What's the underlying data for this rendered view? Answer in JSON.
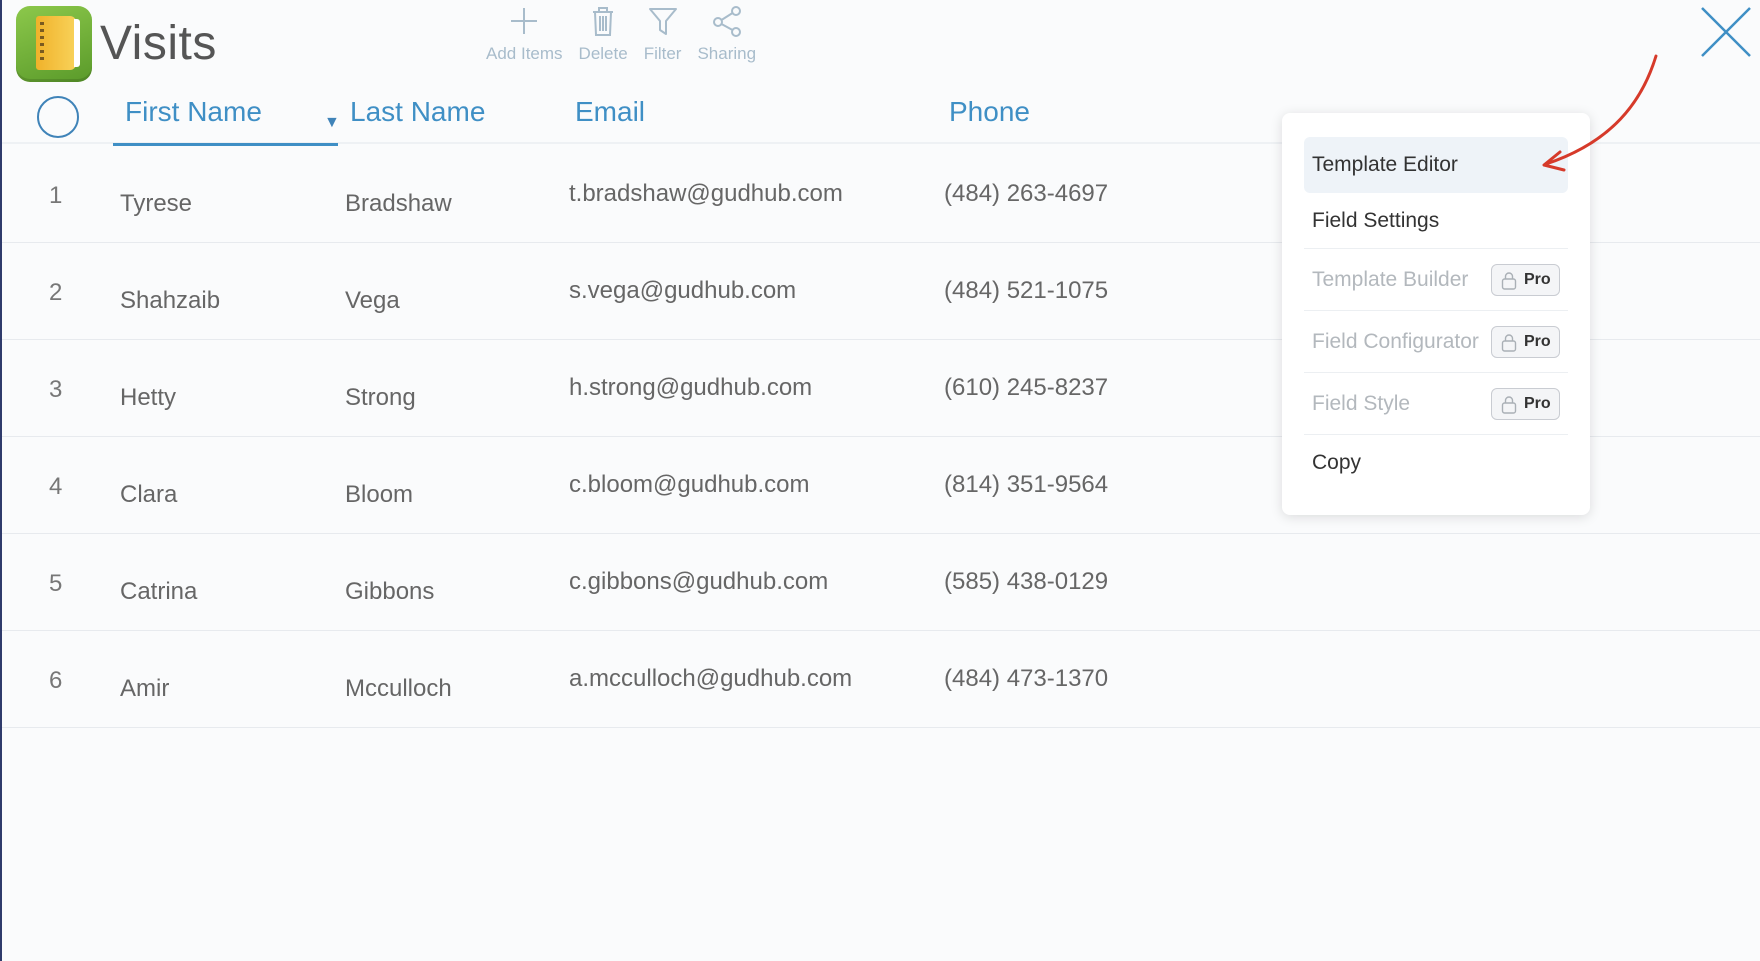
{
  "app": {
    "title": "Visits"
  },
  "toolbar": {
    "add_label": "Add Items",
    "delete_label": "Delete",
    "filter_label": "Filter",
    "sharing_label": "Sharing"
  },
  "columns": {
    "first_name": "First Name",
    "last_name": "Last Name",
    "email": "Email",
    "phone": "Phone"
  },
  "rows": [
    {
      "num": "1",
      "first": "Tyrese",
      "last": "Bradshaw",
      "email": "t.bradshaw@gudhub.com",
      "phone": "(484) 263-4697"
    },
    {
      "num": "2",
      "first": "Shahzaib",
      "last": "Vega",
      "email": "s.vega@gudhub.com",
      "phone": "(484) 521-1075"
    },
    {
      "num": "3",
      "first": "Hetty",
      "last": "Strong",
      "email": "h.strong@gudhub.com",
      "phone": "(610) 245-8237"
    },
    {
      "num": "4",
      "first": "Clara",
      "last": "Bloom",
      "email": "c.bloom@gudhub.com",
      "phone": "(814) 351-9564"
    },
    {
      "num": "5",
      "first": "Catrina",
      "last": "Gibbons",
      "email": "c.gibbons@gudhub.com",
      "phone": "(585) 438-0129"
    },
    {
      "num": "6",
      "first": "Amir",
      "last": "Mcculloch",
      "email": "a.mcculloch@gudhub.com",
      "phone": "(484) 473-1370"
    }
  ],
  "menu": {
    "template_editor": "Template Editor",
    "field_settings": "Field Settings",
    "template_builder": "Template Builder",
    "field_configurator": "Field Configurator",
    "field_style": "Field Style",
    "copy": "Copy",
    "pro_label": "Pro"
  },
  "colors": {
    "accent": "#3f8fc5",
    "toolbar_icon": "#a8bccb",
    "annotation_arrow": "#d63a2a"
  }
}
